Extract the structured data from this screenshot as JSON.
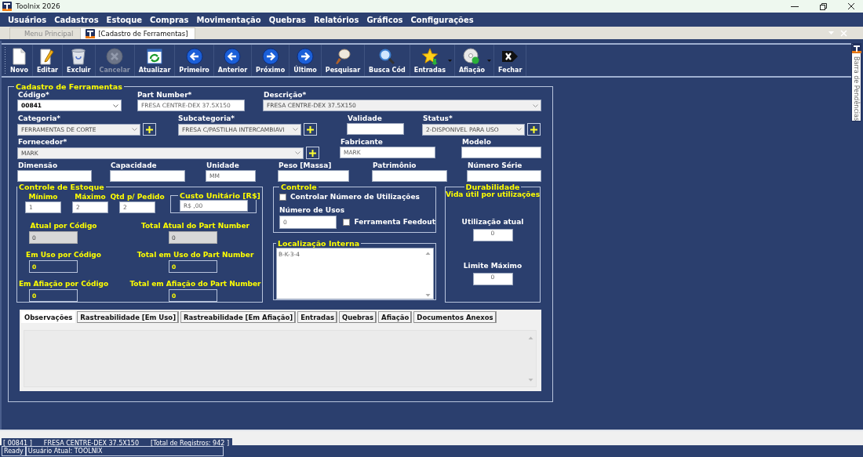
{
  "window": {
    "title": "Toolnix 2026"
  },
  "menu": [
    "Usuários",
    "Cadastros",
    "Estoque",
    "Compras",
    "Movimentação",
    "Quebras",
    "Relatórios",
    "Gráficos",
    "Configurações"
  ],
  "doc_tabs": [
    {
      "label": "Menu Principal",
      "selected": false
    },
    {
      "label": "[Cadastro de Ferramentas]",
      "selected": true
    }
  ],
  "toolbar": [
    {
      "label": "Novo",
      "kind": "new",
      "disabled": false,
      "dropdown": false
    },
    {
      "label": "Editar",
      "kind": "edit",
      "disabled": false,
      "dropdown": false
    },
    {
      "label": "Excluir",
      "kind": "delete",
      "disabled": false,
      "dropdown": false
    },
    {
      "label": "Cancelar",
      "kind": "cancel",
      "disabled": true,
      "dropdown": false
    },
    {
      "label": "Atualizar",
      "kind": "refresh",
      "disabled": false,
      "dropdown": false
    },
    {
      "label": "Primeiro",
      "kind": "first",
      "disabled": false,
      "dropdown": false
    },
    {
      "label": "Anterior",
      "kind": "prev",
      "disabled": false,
      "dropdown": false
    },
    {
      "label": "Próximo",
      "kind": "next",
      "disabled": false,
      "dropdown": false
    },
    {
      "label": "Último",
      "kind": "last",
      "disabled": false,
      "dropdown": false
    },
    {
      "label": "Pesquisar",
      "kind": "search",
      "disabled": false,
      "dropdown": false
    },
    {
      "label": "Busca Cód",
      "kind": "find",
      "disabled": false,
      "dropdown": false
    },
    {
      "label": "Entradas",
      "kind": "entries",
      "disabled": false,
      "dropdown": true
    },
    {
      "label": "Afiação",
      "kind": "sharpen",
      "disabled": false,
      "dropdown": true
    },
    {
      "label": "Fechar",
      "kind": "close",
      "disabled": false,
      "dropdown": false
    }
  ],
  "form": {
    "title": "Cadastro de Ferramentas",
    "rows": [
      {
        "fields": [
          {
            "label": "Código*",
            "value": "00841",
            "kind": "combo",
            "disabled": false,
            "add_button": false
          },
          {
            "label": "Part Number*",
            "value": "FRESA CENTRE-DEX 37.5X150",
            "kind": "text",
            "disabled": false,
            "add_button": false
          },
          {
            "label": "Descrição*",
            "value": "FRESA CENTRE-DEX 37.5X150",
            "kind": "combo",
            "disabled": true,
            "add_button": false
          }
        ]
      },
      {
        "fields": [
          {
            "label": "Categoria*",
            "value": "FERRAMENTAS DE CORTE",
            "kind": "combo",
            "disabled": true,
            "add_button": true
          },
          {
            "label": "Subcategoria*",
            "value": "FRESA C/PASTILHA INTERCAMBIAVI",
            "kind": "combo",
            "disabled": true,
            "add_button": true
          },
          {
            "label": "Validade",
            "kind": "text",
            "disabled": false,
            "add_button": false
          },
          {
            "label": "Status*",
            "value": "2-DISPONIVEL PARA USO",
            "kind": "combo",
            "disabled": true,
            "add_button": true
          }
        ]
      },
      {
        "fields": [
          {
            "label": "Fornecedor*",
            "value": "MARK",
            "kind": "combo",
            "disabled": true,
            "add_button": true
          },
          {
            "label": "Fabricante",
            "value": "MARK",
            "kind": "text",
            "disabled": false,
            "add_button": false
          },
          {
            "label": "Modelo",
            "kind": "text",
            "disabled": false,
            "add_button": false
          }
        ]
      },
      {
        "fields": [
          {
            "label": "Dimensão",
            "kind": "text",
            "disabled": false,
            "add_button": false
          },
          {
            "label": "Capacidade",
            "kind": "text",
            "disabled": false,
            "add_button": false
          },
          {
            "label": "Unidade",
            "value": "MM",
            "kind": "text",
            "disabled": false,
            "add_button": false
          },
          {
            "label": "Peso [Massa]",
            "kind": "text",
            "disabled": false,
            "add_button": false
          },
          {
            "label": "Patrimônio",
            "kind": "text",
            "disabled": false,
            "add_button": false
          },
          {
            "label": "Número Série",
            "kind": "text",
            "disabled": false,
            "add_button": false
          }
        ]
      }
    ],
    "stock": {
      "title": "Controle de Estoque",
      "inputs": [
        {
          "label": "Mínimo",
          "value": "1"
        },
        {
          "label": "Máximo",
          "value": "2"
        },
        {
          "label": "Qtd p/ Pedido",
          "value": "2"
        }
      ],
      "cost": {
        "label": "Custo Unitário [R$]",
        "value": "R$ ,00"
      },
      "counters": [
        {
          "label": "Atual por Código",
          "value": "0",
          "disabled": true
        },
        {
          "label": "Total Atual do Part Number",
          "value": "0",
          "disabled": true
        },
        {
          "label": "Em Uso por Código",
          "value": "0",
          "disabled": false
        },
        {
          "label": "Total em Uso do Part Number",
          "value": "0",
          "disabled": false
        },
        {
          "label": "Em Afiação por Código",
          "value": "0",
          "disabled": false
        },
        {
          "label": "Total em Afiação do Part Number",
          "value": "0",
          "disabled": false
        }
      ]
    },
    "control": {
      "title": "Controle",
      "use_limit": {
        "label": "Controlar Número de Utilizações",
        "checked": false
      },
      "uses": {
        "label": "Número de Usos",
        "value": "0"
      },
      "feedout": {
        "label": "Ferramenta Feedout",
        "checked": false
      }
    },
    "location": {
      "title": "Localização Interna",
      "value": "B-K-3-4"
    },
    "durability": {
      "title": "Durabilidade",
      "subtitle": "Vida útil por utilizações",
      "current": {
        "label": "Utilização atual",
        "value": "0"
      },
      "max": {
        "label": "Limite Máximo",
        "value": "0"
      }
    },
    "tabs": [
      {
        "label": "Observações",
        "selected": true
      },
      {
        "label": "Rastreabilidade [Em Uso]",
        "selected": false
      },
      {
        "label": "Rastreabilidade [Em Afiação]",
        "selected": false
      },
      {
        "label": "Entradas",
        "selected": false
      },
      {
        "label": "Quebras",
        "selected": false
      },
      {
        "label": "Afiação",
        "selected": false
      },
      {
        "label": "Documentos Anexos",
        "selected": false
      }
    ]
  },
  "record_bar": [
    "[ 00841 ]",
    "FRESA CENTRE-DEX 37.5X150",
    "[Total de Registros: 942 ]"
  ],
  "status_bar": [
    "Ready",
    "Usuário Atual: TOOLNIX"
  ],
  "side_panel": {
    "title": "Barra de Pendências"
  }
}
